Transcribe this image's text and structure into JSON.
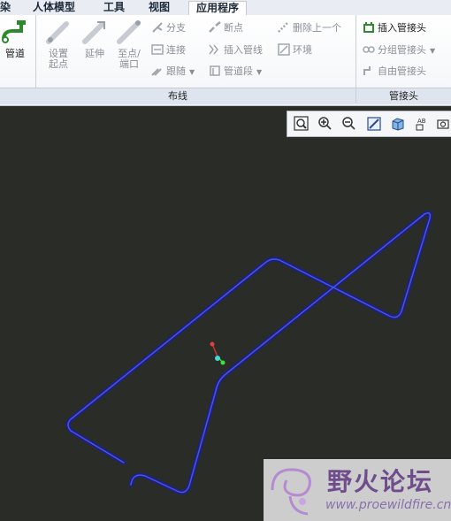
{
  "menu": {
    "items": [
      "染",
      "人体模型",
      "工具",
      "视图",
      "应用程序"
    ],
    "active_index": 4
  },
  "ribbon": {
    "group_routing": "布线",
    "group_fittings": "管接头",
    "buttons": {
      "pipe": "管道",
      "set_start": "设置\n起点",
      "extend": "延伸",
      "to_point": "至点/\n端口",
      "branch": "分支",
      "connect": "连接",
      "follow": "跟随",
      "break": "断点",
      "insert_pipeline": "插入管线",
      "pipe_segment": "管道段",
      "delete_last": "删除上一个",
      "environment": "环境",
      "insert_fitting": "插入管接头",
      "group_fitting": "分组管接头",
      "free_fitting": "自由管接头"
    }
  },
  "view_toolbar": {
    "icons": [
      "zoom-fit-icon",
      "zoom-in-icon",
      "zoom-out-icon",
      "repaint-icon",
      "display-style-icon",
      "view-manager-icon",
      "saved-views-icon"
    ]
  },
  "colors": {
    "viewport_bg": "#2a2c27",
    "pipe": "#1b1f8c",
    "pipe_highlight": "#4a55d8",
    "ribbon_accent": "#2c8a2c"
  },
  "watermark": {
    "title": "野火论坛",
    "url": "www.proewildfire.cn"
  }
}
